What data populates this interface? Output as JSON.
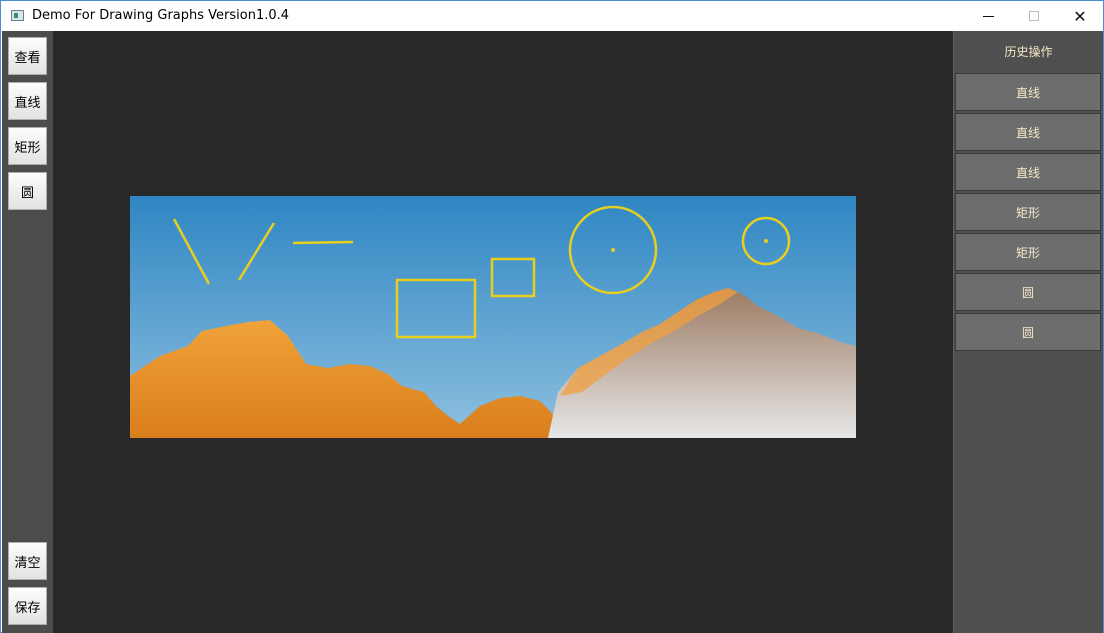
{
  "window": {
    "title": "Demo For Drawing Graphs Version1.0.4",
    "icons": {
      "app": "app-window-icon",
      "minimize": "minimize-icon",
      "maximize": "maximize-icon",
      "close": "close-icon"
    },
    "close_glyph": "✕"
  },
  "toolbar": {
    "top_buttons": [
      "查看",
      "直线",
      "矩形",
      "圆"
    ],
    "bottom_buttons": [
      "清空",
      "保存"
    ]
  },
  "history": {
    "header": "历史操作",
    "items": [
      "直线",
      "直线",
      "直线",
      "矩形",
      "矩形",
      "圆",
      "圆"
    ]
  },
  "colors": {
    "shape_stroke": "#e8cf1e",
    "canvas_bg": "#282828",
    "toolbar_bg": "#4c4c4c",
    "panel_bg": "#4f4f4f",
    "history_item_bg": "#6d6d6d",
    "history_text": "#f4e8c8"
  }
}
